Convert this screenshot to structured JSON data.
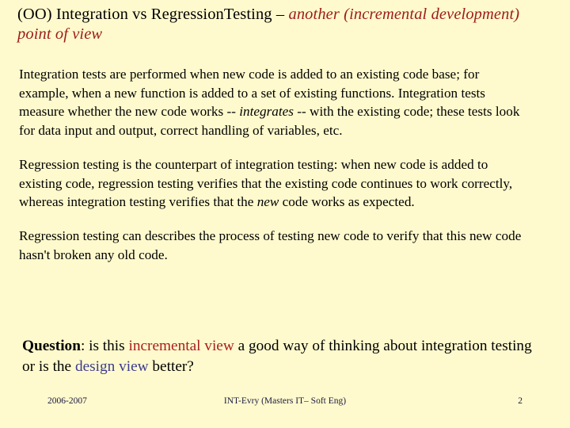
{
  "slide": {
    "background_color": "#fffacd",
    "title": {
      "plain_prefix": "(OO) Integration vs RegressionTesting – ",
      "accent_text": "another (incremental development) point of view",
      "accent_color": "#9e1b1b",
      "plain_color": "#000000"
    },
    "paragraphs": [
      {
        "segment_1": "Integration tests are performed when new code is added to an existing code base; for example, when a new function is added to a set of existing functions. Integration tests measure whether the new code works -- ",
        "emphasis": "integrates",
        "segment_2": " -- with the existing code; these tests look for data input and output, correct handling of variables, etc."
      },
      {
        "segment_1": "Regression testing is the counterpart of integration testing: when new code is added to existing code, regression testing verifies that the existing code continues to work correctly, whereas integration testing verifies that the ",
        "emphasis": "new",
        "segment_2": " code works as expected."
      },
      {
        "segment_1": "Regression testing can describes the process of testing new code to verify that this new code hasn't broken any old code.",
        "emphasis": "",
        "segment_2": ""
      }
    ],
    "question": {
      "label": "Question",
      "after_label": ": is this ",
      "accent_red_text": "incremental view",
      "middle_text": " a good way of thinking about integration testing or is the ",
      "accent_blue_text": "design view",
      "tail_text": " better?",
      "accent_red_color": "#a81f1f",
      "accent_blue_color": "#3c3c8f"
    },
    "footer": {
      "date": "2006-2007",
      "center": "INT-Evry (Masters IT– Soft Eng)",
      "page_number": "2",
      "color": "#1a1a40"
    }
  }
}
